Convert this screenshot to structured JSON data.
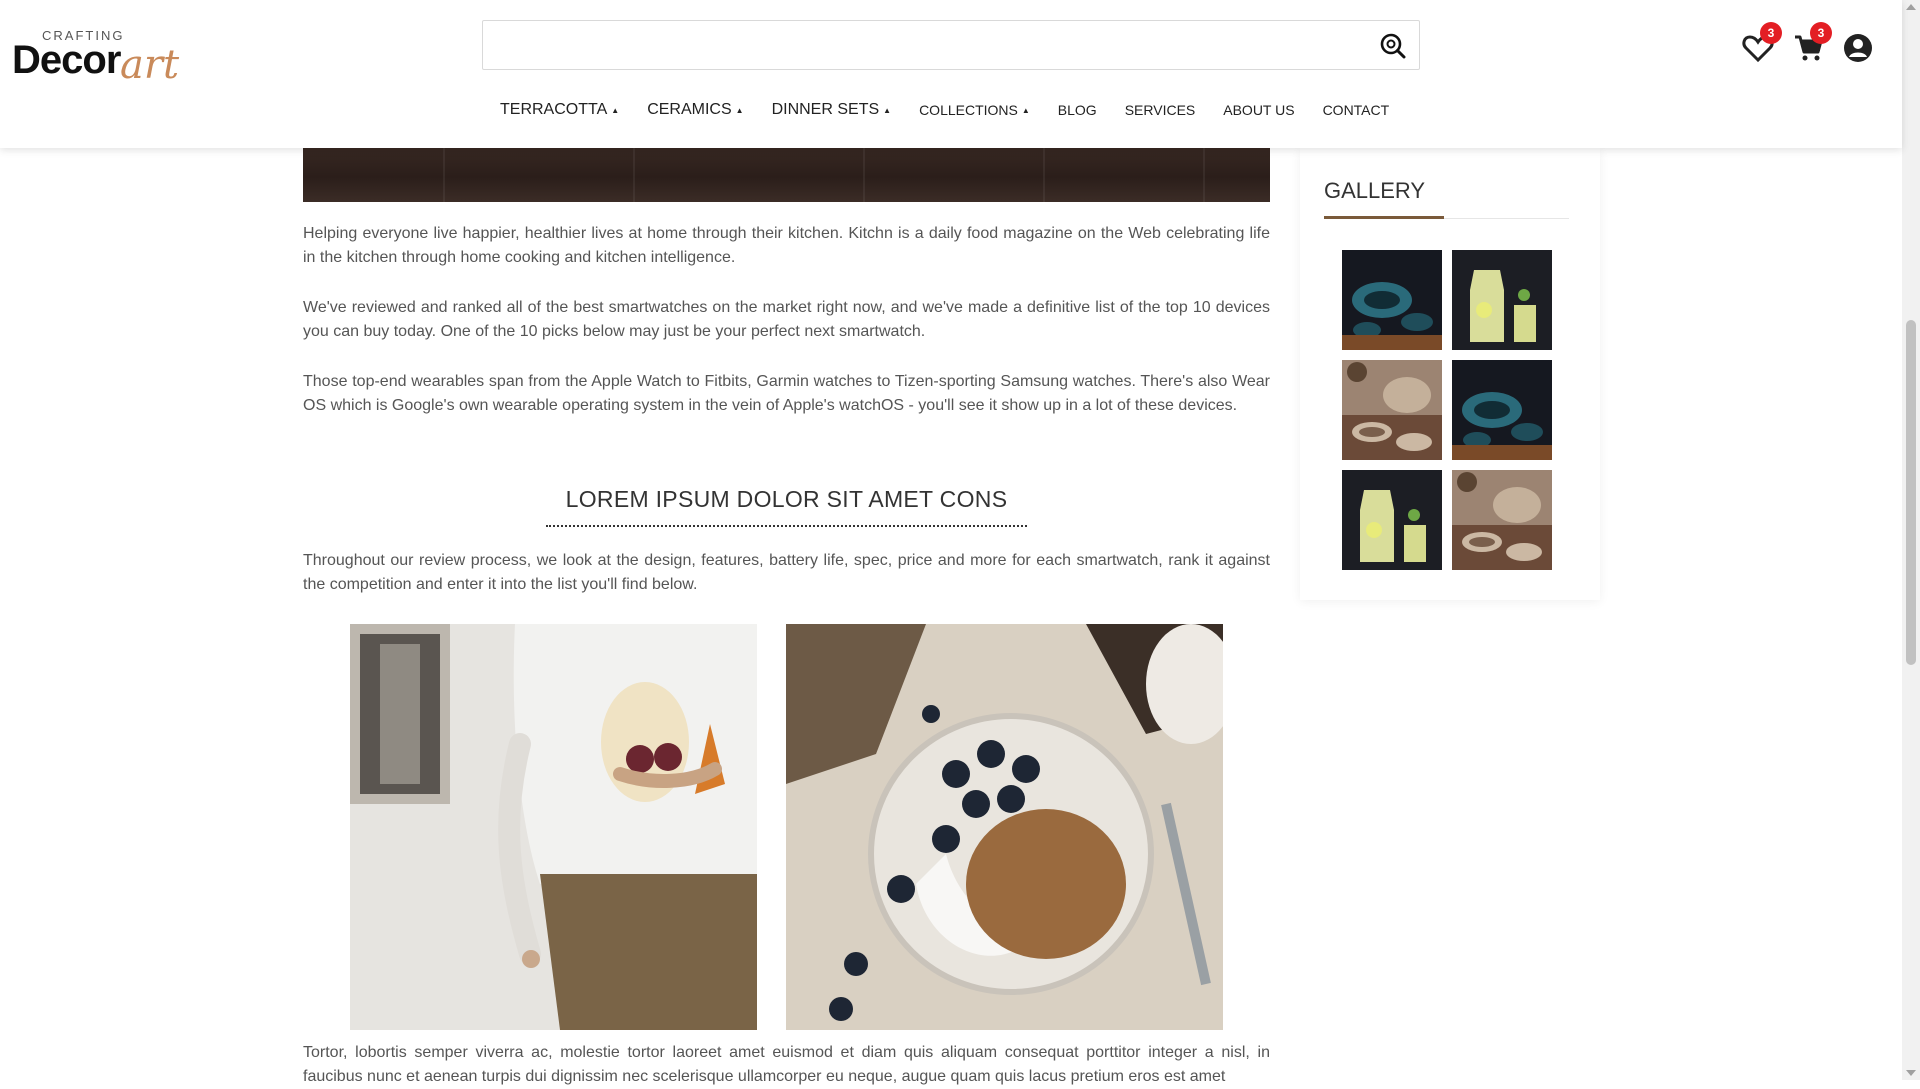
{
  "brand": {
    "top": "CRAFTING",
    "main": "Decor",
    "script": "art"
  },
  "search": {
    "value": "",
    "placeholder": ""
  },
  "header_icons": {
    "wishlist_count": "3",
    "cart_count": "3"
  },
  "nav": [
    {
      "label": "TERRACOTTA",
      "dropdown": true
    },
    {
      "label": "CERAMICS",
      "dropdown": true
    },
    {
      "label": "DINNER SETS",
      "dropdown": true
    },
    {
      "label": "COLLECTIONS",
      "dropdown": true
    },
    {
      "label": "BLOG",
      "dropdown": false
    },
    {
      "label": "SERVICES",
      "dropdown": false
    },
    {
      "label": "ABOUT US",
      "dropdown": false
    },
    {
      "label": "CONTACT",
      "dropdown": false
    }
  ],
  "article": {
    "paragraphs": [
      "Helping everyone live happier, healthier lives at home through their kitchen. Kitchn is a daily food magazine on the Web celebrating life in the kitchen through home cooking and kitchen intelligence.",
      "We've reviewed and ranked all of the best smartwatches on the market right now, and we've made a definitive list of the top 10 devices you can buy today. One of the 10 picks below may just be your perfect next smartwatch.",
      "Those top-end wearables span from the Apple Watch to Fitbits, Garmin watches to Tizen-sporting Samsung watches. There's also Wear OS which is Google's own wearable operating system in the vein of Apple's watchOS - you'll see it show up in a lot of these devices."
    ],
    "subheading": "LOREM IPSUM DOLOR SIT AMET CONS",
    "paragraph_after": "Throughout our review process, we look at the design, features, battery life, spec, price and more for each smartwatch, rank it against the competition and enter it into the list you'll find below.",
    "paragraph_bottom": "Tortor, lobortis semper viverra ac, molestie tortor laoreet amet euismod et diam quis aliquam consequat porttitor integer a nisl, in faucibus nunc et aenean turpis dui dignissim nec scelerisque ullamcorper eu neque, augue quam quis lacus pretium eros est amet"
  },
  "sidebar": {
    "gallery_title": "GALLERY"
  },
  "colors": {
    "accent": "#7a5a3a",
    "badge": "#e31e24",
    "brand_script": "#c98a5a"
  }
}
